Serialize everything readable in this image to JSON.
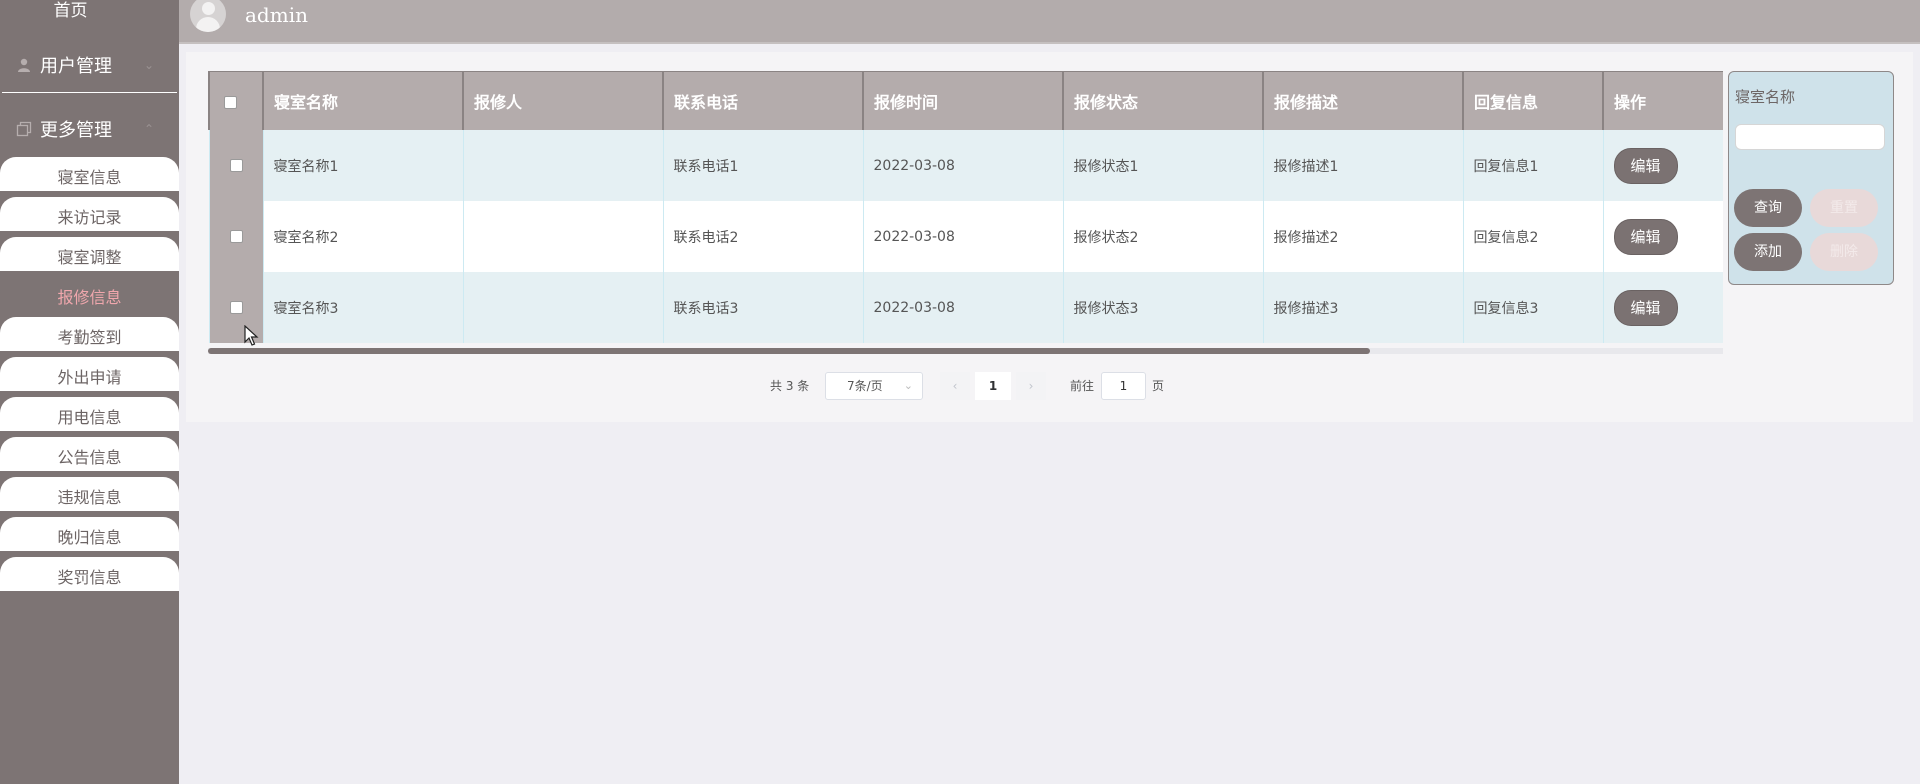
{
  "sidebar": {
    "home": "首页",
    "groups": [
      {
        "label": "用户管理",
        "icon": "user-icon"
      },
      {
        "label": "更多管理",
        "icon": "copy-icon"
      }
    ],
    "items": [
      {
        "label": "寝室信息"
      },
      {
        "label": "来访记录"
      },
      {
        "label": "寝室调整"
      },
      {
        "label": "报修信息",
        "active": true
      },
      {
        "label": "考勤签到"
      },
      {
        "label": "外出申请"
      },
      {
        "label": "用电信息"
      },
      {
        "label": "公告信息"
      },
      {
        "label": "违规信息"
      },
      {
        "label": "晚归信息"
      },
      {
        "label": "奖罚信息"
      }
    ]
  },
  "header": {
    "username": "admin",
    "avatar_icon": "avatar-icon"
  },
  "table": {
    "columns": [
      "寝室名称",
      "报修人",
      "联系电话",
      "报修时间",
      "报修状态",
      "报修描述",
      "回复信息",
      "操作"
    ],
    "rows": [
      {
        "room": "寝室名称1",
        "reporter": "",
        "phone": "联系电话1",
        "time": "2022-03-08",
        "status": "报修状态1",
        "desc": "报修描述1",
        "reply": "回复信息1"
      },
      {
        "room": "寝室名称2",
        "reporter": "",
        "phone": "联系电话2",
        "time": "2022-03-08",
        "status": "报修状态2",
        "desc": "报修描述2",
        "reply": "回复信息2"
      },
      {
        "room": "寝室名称3",
        "reporter": "",
        "phone": "联系电话3",
        "time": "2022-03-08",
        "status": "报修状态3",
        "desc": "报修描述3",
        "reply": "回复信息3"
      }
    ],
    "edit_label": "编辑"
  },
  "search": {
    "label": "寝室名称",
    "value": "",
    "query_label": "查询",
    "reset_label": "重置",
    "add_label": "添加",
    "delete_label": "删除"
  },
  "pagination": {
    "total_text": "共 3 条",
    "page_size": "7条/页",
    "current_page": "1",
    "goto_label": "前往",
    "goto_value": "1",
    "page_suffix": "页"
  },
  "colors": {
    "sidebar": "#7d7474",
    "topbar": "#b3acac",
    "active_text": "#f0a7ad",
    "row_alt": "#e5f0f3",
    "search_panel": "#cfe2ea"
  }
}
